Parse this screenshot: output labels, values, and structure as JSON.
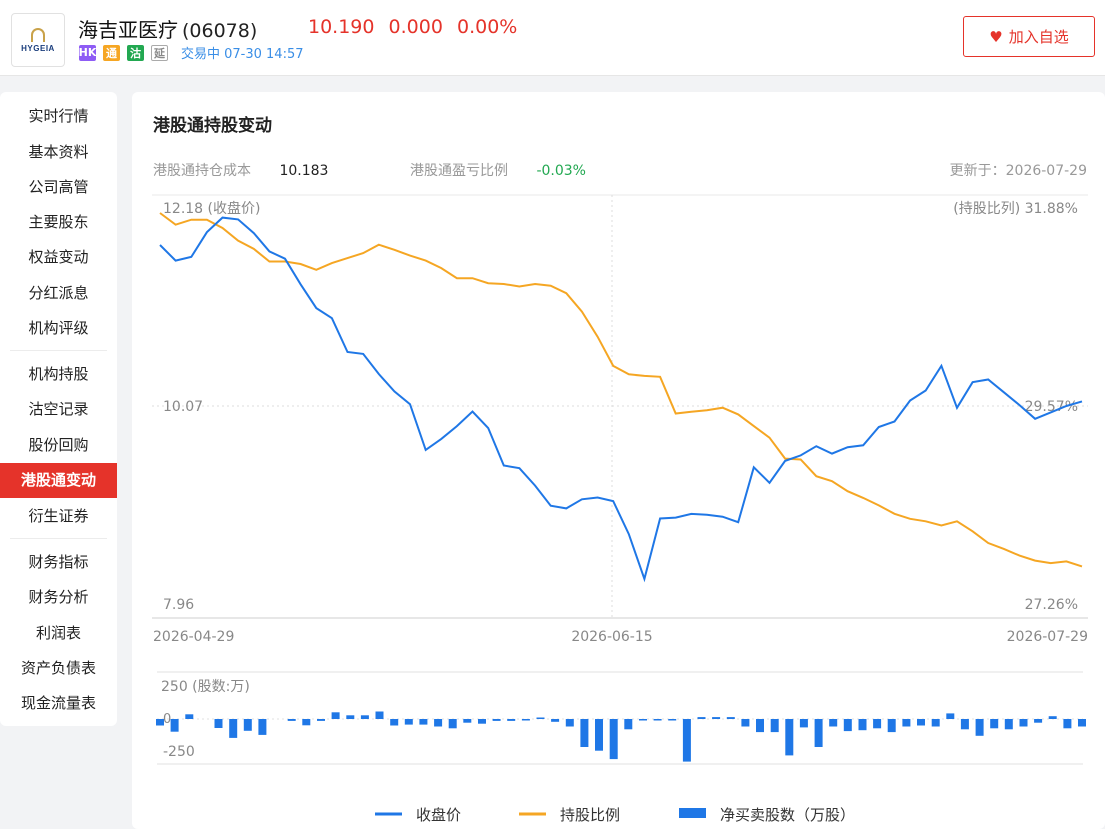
{
  "header": {
    "logo_text": "HYGEIA",
    "stock_name": "海吉亚医疗",
    "stock_code": "(06078)",
    "price": "10.190",
    "change": "0.000",
    "change_pct": "0.00%",
    "tags": [
      "HK",
      "通",
      "沽",
      "延"
    ],
    "trade_status": "交易中 07-30 14:57",
    "fav_label": "加入自选"
  },
  "sidebar": {
    "items": [
      "实时行情",
      "基本资料",
      "公司高管",
      "主要股东",
      "权益变动",
      "分红派息",
      "机构评级",
      "机构持股",
      "沽空记录",
      "股份回购",
      "港股通变动",
      "衍生证券",
      "财务指标",
      "财务分析",
      "利润表",
      "资产负债表",
      "现金流量表"
    ],
    "active": "港股通变动"
  },
  "panel": {
    "title": "港股通持股变动",
    "cost_label": "港股通持仓成本",
    "cost_value": "10.183",
    "pl_label": "港股通盈亏比例",
    "pl_value": "-0.03%",
    "updated": "更新于：2026-07-29"
  },
  "colors": {
    "price": "#1f77e6",
    "ratio": "#f5a623",
    "bars": "#1f77e6",
    "up": "#e5332a",
    "down": "#22a851"
  },
  "chart_data": {
    "type": "line",
    "x_start": "2026-04-29",
    "x_mid": "2026-06-15",
    "x_end": "2026-07-29",
    "y_left_top": "12.18 (收盘价)",
    "y_left_mid": "10.07",
    "y_left_bottom": "7.96",
    "y_right_top": "(持股比列) 31.88%",
    "y_right_mid": "29.57%",
    "y_right_bottom": "27.26%",
    "price_range": [
      7.96,
      12.18
    ],
    "ratio_range": [
      27.26,
      31.88
    ],
    "series": [
      {
        "name": "收盘价",
        "values": [
          11.83,
          11.66,
          11.7,
          11.97,
          12.13,
          12.11,
          11.96,
          11.76,
          11.68,
          11.4,
          11.14,
          11.03,
          10.66,
          10.64,
          10.42,
          10.23,
          10.09,
          9.59,
          9.71,
          9.85,
          10.01,
          9.83,
          9.42,
          9.39,
          9.2,
          8.98,
          8.95,
          9.05,
          9.07,
          9.03,
          8.67,
          8.18,
          8.84,
          8.85,
          8.89,
          8.88,
          8.86,
          8.8,
          9.4,
          9.23,
          9.47,
          9.53,
          9.63,
          9.55,
          9.62,
          9.64,
          9.84,
          9.9,
          10.13,
          10.24,
          10.51,
          10.05,
          10.33,
          10.36,
          10.22,
          10.08,
          9.93,
          10.0,
          10.07,
          10.12
        ]
      },
      {
        "name": "持股比例",
        "values": [
          31.88,
          31.74,
          31.8,
          31.8,
          31.7,
          31.55,
          31.45,
          31.3,
          31.3,
          31.27,
          31.2,
          31.28,
          31.34,
          31.4,
          31.5,
          31.44,
          31.37,
          31.31,
          31.22,
          31.1,
          31.1,
          31.04,
          31.03,
          31.0,
          31.03,
          31.01,
          30.92,
          30.7,
          30.4,
          30.05,
          29.95,
          29.93,
          29.92,
          29.48,
          29.5,
          29.52,
          29.55,
          29.47,
          29.33,
          29.19,
          28.94,
          28.93,
          28.73,
          28.67,
          28.55,
          28.47,
          28.38,
          28.28,
          28.22,
          28.19,
          28.14,
          28.19,
          28.07,
          27.93,
          27.86,
          27.78,
          27.72,
          27.69,
          27.71,
          27.65
        ]
      },
      {
        "name": "净买卖股数（万股）",
        "values": [
          -35,
          -68,
          25,
          0,
          -48,
          -101,
          -63,
          -85,
          0,
          -10,
          -34,
          -10,
          36,
          20,
          20,
          40,
          -35,
          -30,
          -30,
          -40,
          -50,
          -20,
          -25,
          -10,
          -10,
          -8,
          8,
          -15,
          -40,
          -150,
          -170,
          -215,
          -55,
          -8,
          -8,
          -5,
          -228,
          10,
          10,
          10,
          -40,
          -70,
          -70,
          -195,
          -45,
          -150,
          -40,
          -65,
          -60,
          -50,
          -70,
          -40,
          -35,
          -40,
          30,
          -55,
          -90,
          -50,
          -55,
          -40,
          -20,
          15,
          -50,
          -40
        ]
      }
    ],
    "bar_axis_top": "250 (股数:万)",
    "bar_axis_zero": "0",
    "bar_axis_bottom": "-250",
    "bar_range": [
      -300,
      300
    ],
    "legend": [
      "收盘价",
      "持股比例",
      "净买卖股数（万股）"
    ]
  }
}
